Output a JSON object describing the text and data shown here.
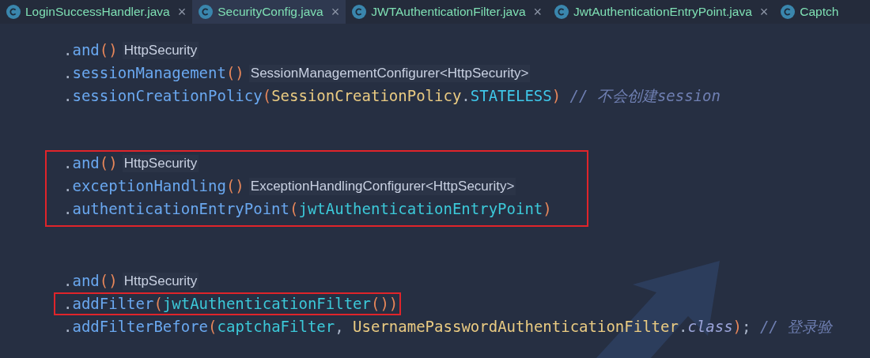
{
  "tabs": [
    {
      "label": "LoginSuccessHandler.java",
      "close": "×",
      "selected": false
    },
    {
      "label": "SecurityConfig.java",
      "close": "×",
      "selected": true
    },
    {
      "label": "JWTAuthenticationFilter.java",
      "close": "×",
      "selected": false
    },
    {
      "label": "JwtAuthenticationEntryPoint.java",
      "close": "×",
      "selected": false
    },
    {
      "label": "Captch",
      "selected": false
    }
  ],
  "code_blocks": [
    {
      "boxed": false,
      "lines": [
        {
          "boxed": false,
          "tokens": [
            {
              "kind": "punct",
              "text": "."
            },
            {
              "kind": "method",
              "text": "and"
            },
            {
              "kind": "paren",
              "text": "()"
            }
          ],
          "hint": "HttpSecurity"
        },
        {
          "boxed": false,
          "tokens": [
            {
              "kind": "punct",
              "text": "."
            },
            {
              "kind": "method",
              "text": "sessionManagement"
            },
            {
              "kind": "paren",
              "text": "()"
            }
          ],
          "hint": "SessionManagementConfigurer<HttpSecurity>"
        },
        {
          "boxed": false,
          "tokens": [
            {
              "kind": "punct",
              "text": "."
            },
            {
              "kind": "method",
              "text": "sessionCreationPolicy"
            },
            {
              "kind": "paren",
              "text": "("
            },
            {
              "kind": "type",
              "text": "SessionCreationPolicy"
            },
            {
              "kind": "punct",
              "text": "."
            },
            {
              "kind": "field",
              "text": "STATELESS"
            },
            {
              "kind": "paren",
              "text": ")"
            },
            {
              "kind": "comment",
              "text": "// 不会创建session"
            }
          ]
        }
      ]
    },
    {
      "boxed": true,
      "lines": [
        {
          "boxed": false,
          "tokens": [
            {
              "kind": "punct",
              "text": "."
            },
            {
              "kind": "method",
              "text": "and"
            },
            {
              "kind": "paren",
              "text": "()"
            }
          ],
          "hint": "HttpSecurity"
        },
        {
          "boxed": false,
          "tokens": [
            {
              "kind": "punct",
              "text": "."
            },
            {
              "kind": "method",
              "text": "exceptionHandling"
            },
            {
              "kind": "paren",
              "text": "()"
            }
          ],
          "hint": "ExceptionHandlingConfigurer<HttpSecurity>"
        },
        {
          "boxed": false,
          "tokens": [
            {
              "kind": "punct",
              "text": "."
            },
            {
              "kind": "method",
              "text": "authenticationEntryPoint"
            },
            {
              "kind": "paren",
              "text": "("
            },
            {
              "kind": "variable",
              "text": "jwtAuthenticationEntryPoint"
            },
            {
              "kind": "paren",
              "text": ")"
            }
          ]
        }
      ]
    },
    {
      "boxed": false,
      "lines": [
        {
          "boxed": false,
          "tokens": [
            {
              "kind": "punct",
              "text": "."
            },
            {
              "kind": "method",
              "text": "and"
            },
            {
              "kind": "paren",
              "text": "()"
            }
          ],
          "hint": "HttpSecurity"
        },
        {
          "boxed": true,
          "tokens": [
            {
              "kind": "punct",
              "text": "."
            },
            {
              "kind": "method",
              "text": "addFilter"
            },
            {
              "kind": "paren",
              "text": "("
            },
            {
              "kind": "variable",
              "text": "jwtAuthenticationFilter"
            },
            {
              "kind": "paren",
              "text": "())"
            }
          ]
        },
        {
          "boxed": false,
          "tokens": [
            {
              "kind": "punct",
              "text": "."
            },
            {
              "kind": "method",
              "text": "addFilterBefore"
            },
            {
              "kind": "paren",
              "text": "("
            },
            {
              "kind": "variable",
              "text": "captchaFilter"
            },
            {
              "kind": "punct",
              "text": ", "
            },
            {
              "kind": "type",
              "text": "UsernamePasswordAuthenticationFilter"
            },
            {
              "kind": "punct",
              "text": "."
            },
            {
              "kind": "keyword",
              "text": "class"
            },
            {
              "kind": "paren",
              "text": ")"
            },
            {
              "kind": "punct",
              "text": ";"
            },
            {
              "kind": "comment",
              "text": "// 登录验"
            }
          ]
        }
      ]
    }
  ]
}
